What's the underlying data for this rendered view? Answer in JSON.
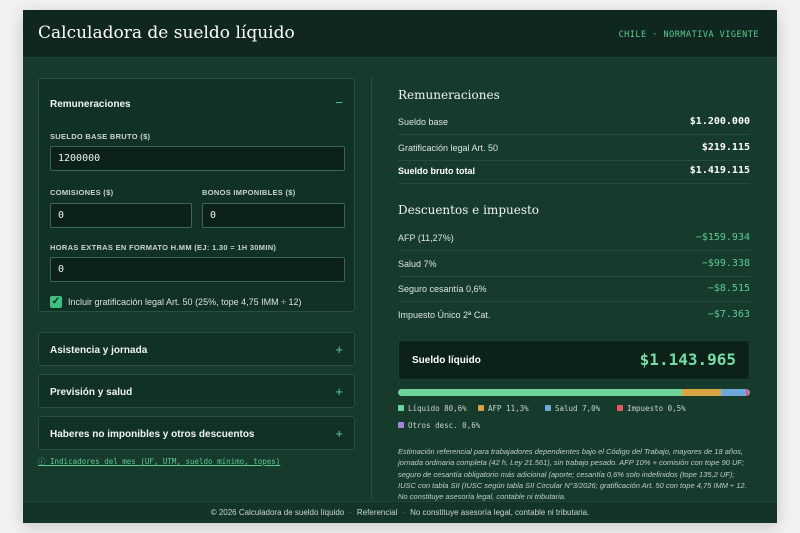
{
  "header": {
    "title": "Calculadora de sueldo líquido",
    "tag": "CHILE · NORMATIVA VIGENTE"
  },
  "panels": {
    "remuneraciones": {
      "title": "Remuneraciones",
      "toggle": "−",
      "sueldo_base_label": "SUELDO BASE BRUTO ($)",
      "sueldo_base_value": "1200000",
      "comisiones_label": "COMISIONES ($)",
      "comisiones_value": "0",
      "bonos_label": "BONOS IMPONIBLES ($)",
      "bonos_value": "0",
      "horas_label": "HORAS EXTRAS EN FORMATO H.MM (EJ: 1.30 = 1H 30MIN)",
      "horas_value": "0",
      "gratificacion_checked": true,
      "gratificacion_label": "Incluir gratificación legal Art. 50 (25%, tope 4,75 IMM ÷ 12)"
    },
    "asistencia": {
      "title": "Asistencia y jornada",
      "toggle": "+"
    },
    "prevision": {
      "title": "Previsión y salud",
      "toggle": "+"
    },
    "haberes": {
      "title": "Haberes no imponibles y otros descuentos",
      "toggle": "+"
    }
  },
  "indicadores_link": "ⓘ Indicadores del mes (UF, UTM, sueldo mínimo, topes)",
  "results": {
    "remuneraciones_title": "Remuneraciones",
    "remuneraciones": [
      {
        "label": "Sueldo base",
        "value": "$1.200.000"
      },
      {
        "label": "Gratificación legal Art. 50",
        "value": "$219.115"
      },
      {
        "label": "Sueldo bruto total",
        "value": "$1.419.115"
      }
    ],
    "descuentos_title": "Descuentos e impuesto",
    "descuentos": [
      {
        "label": "AFP (11,27%)",
        "value": "−$159.934"
      },
      {
        "label": "Salud 7%",
        "value": "−$99.338"
      },
      {
        "label": "Seguro cesantía 0,6%",
        "value": "−$8.515"
      },
      {
        "label": "Impuesto Único 2ª Cat.",
        "value": "−$7.363"
      }
    ],
    "liquido_label": "Sueldo líquido",
    "liquido_value": "$1.143.965"
  },
  "distribution": [
    {
      "label": "Líquido 80,6%",
      "pct": 80.6,
      "color": "#6fd49c"
    },
    {
      "label": "AFP 11,3%",
      "pct": 11.3,
      "color": "#d9a441"
    },
    {
      "label": "Salud 7,0%",
      "pct": 7.0,
      "color": "#6fa8d8"
    },
    {
      "label": "Impuesto 0,5%",
      "pct": 0.5,
      "color": "#e05c5c"
    },
    {
      "label": "Otros desc. 0,6%",
      "pct": 0.6,
      "color": "#a585d6"
    }
  ],
  "note": "Estimación referencial para trabajadores dependientes bajo el Código del Trabajo, mayores de 18 años, jornada ordinaria completa (42 h, Ley 21.561), sin trabajo pesado. AFP 10% + comisión con tope 90 UF; seguro de cesantía obligatorio más adicional (aporte; cesantía 0,6% solo indefinidos (tope 135,2 UF); IUSC con tabla SII (IUSC según tabla SII Circular N°3/2026; gratificación Art. 50 con tope 4,75 IMM ÷ 12. No constituye asesoría legal, contable ni tributaria.",
  "footer": {
    "copyright": "© 2026 Calculadora de sueldo líquido",
    "referencial": "Referencial",
    "disclaimer": "No constituye asesoría legal, contable ni tributaria."
  }
}
